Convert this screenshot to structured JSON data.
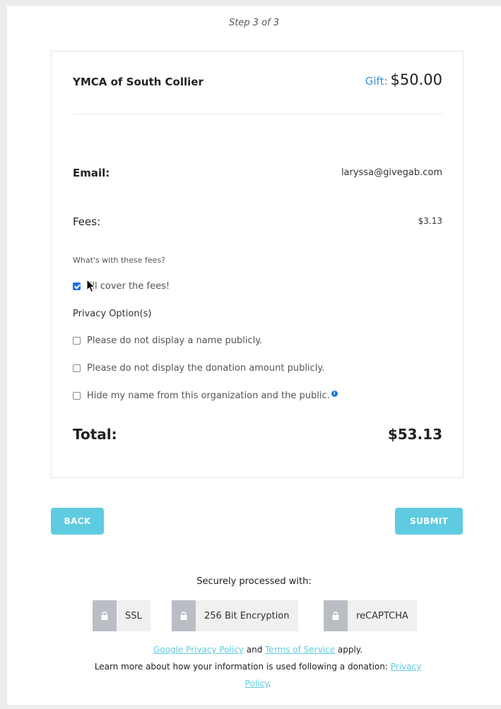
{
  "step": "Step 3 of 3",
  "summary": {
    "org_name": "YMCA of South Collier",
    "gift_label": "Gift:",
    "gift_amount": "$50.00",
    "email_label": "Email:",
    "email_value": "laryssa@givegab.com",
    "fees_label": "Fees:",
    "fees_value": "$3.13",
    "fee_help_link": "What's with these fees?",
    "cover_fees_label": "I'll cover the fees!",
    "cover_fees_checked": true,
    "privacy_title": "Privacy Option(s)",
    "privacy_options": [
      {
        "label": "Please do not display a name publicly.",
        "checked": false
      },
      {
        "label": "Please do not display the donation amount publicly.",
        "checked": false
      },
      {
        "label": "Hide my name from this organization and the public.",
        "checked": false
      }
    ],
    "total_label": "Total:",
    "total_value": "$53.13"
  },
  "buttons": {
    "back": "BACK",
    "submit": "SUBMIT"
  },
  "security": {
    "title": "Securely processed with:",
    "badges": [
      "SSL",
      "256 Bit Encryption",
      "reCAPTCHA"
    ]
  },
  "legal": {
    "google_privacy": "Google Privacy Policy",
    "and": "and",
    "terms": "Terms of Service",
    "apply": "apply.",
    "learn_more": "Learn more about how your information is used following a donation:",
    "privacy_link_part1": "Privacy",
    "privacy_link_part2": "Policy",
    "period": "."
  },
  "colors": {
    "accent": "#5fcbe0",
    "gift_label": "#3a8fd1",
    "checkbox": "#1a73e8"
  },
  "icons": {
    "lock": "lock-icon",
    "info": "info-icon",
    "cursor": "mouse-cursor-icon"
  }
}
